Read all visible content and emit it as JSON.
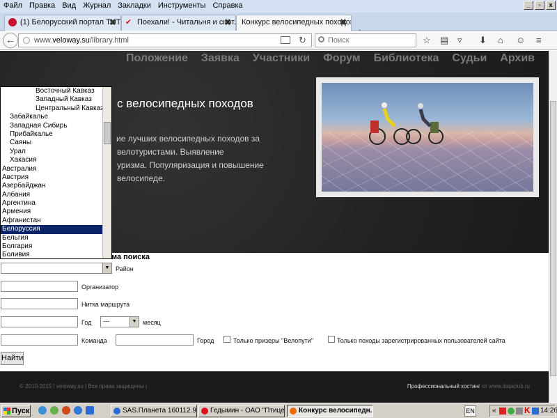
{
  "menu": {
    "items": [
      "Файл",
      "Правка",
      "Вид",
      "Журнал",
      "Закладки",
      "Инструменты",
      "Справка"
    ],
    "win_buttons": [
      "_",
      "▫",
      "x"
    ]
  },
  "tabs": [
    {
      "label": "(1) Белорусский портал TUT...",
      "icon_color": "#c8102e"
    },
    {
      "label": "Поехали! - Читальня и снот...",
      "icon_color": "#d11"
    },
    {
      "label": "Конкурс велосипедных походов ...",
      "icon_color": ""
    }
  ],
  "tab_close": "✖",
  "newtab": "+",
  "nav": {
    "back": "←",
    "url_prefix": "www.",
    "url_domain": "veloway.su",
    "url_path": "/library.html",
    "search_placeholder": "Поиск",
    "reload": "↻"
  },
  "page": {
    "topnav": [
      "Положение",
      "Заявка",
      "Участники",
      "Форум",
      "Библиотека",
      "Судьи",
      "Архив"
    ],
    "hero_title": "с велосипедных походов",
    "hero_desc_lines": [
      "ие лучших велосипедных походов за",
      "велотуристами. Выявление",
      "уризма. Популяризация и повышение",
      "велосипеде."
    ],
    "form_title": "ма поиска",
    "labels": {
      "region": "Район",
      "organizer": "Организатор",
      "route": "Нитка маршрута",
      "year": "Год",
      "month": "месяц",
      "team": "Команда",
      "city": "Город",
      "winners_only": "Только призеры \"Велопути\"",
      "registered_only": "Только походы зарегистрированных пользователей сайта"
    },
    "month_value": "---",
    "find_button": "Найти",
    "footer_left": "© 2010-2015 | veloway.su | Все права защищены |",
    "footer_right_text": "Профессиональный хостинг",
    "footer_right_from": "от",
    "footer_right_domain": "www.dataclub.ru"
  },
  "dropdown": {
    "items": [
      {
        "t": "Восточный Кавказ",
        "lvl": 2
      },
      {
        "t": "Западный Кавказ",
        "lvl": 2
      },
      {
        "t": "Центральный Кавказ",
        "lvl": 2
      },
      {
        "t": "Забайкалье",
        "lvl": 1
      },
      {
        "t": "Западная Сибирь",
        "lvl": 1
      },
      {
        "t": "Прибайкалье",
        "lvl": 1
      },
      {
        "t": "Саяны",
        "lvl": 1
      },
      {
        "t": "Урал",
        "lvl": 1
      },
      {
        "t": "Хакасия",
        "lvl": 1
      },
      {
        "t": "Австралия",
        "lvl": 0
      },
      {
        "t": "Австрия",
        "lvl": 0
      },
      {
        "t": "Азербайджан",
        "lvl": 0
      },
      {
        "t": "Албания",
        "lvl": 0
      },
      {
        "t": "Аргентина",
        "lvl": 0
      },
      {
        "t": "Армения",
        "lvl": 0
      },
      {
        "t": "Афганистан",
        "lvl": 0
      },
      {
        "t": "Белоруссия",
        "lvl": 0,
        "selected": true
      },
      {
        "t": "Бельгия",
        "lvl": 0
      },
      {
        "t": "Болгария",
        "lvl": 0
      },
      {
        "t": "Боливия",
        "lvl": 0
      }
    ]
  },
  "taskbar": {
    "start": "Пуск",
    "tasks": [
      {
        "label": "SAS.Планета 160112.9...",
        "icon_color": "#2a6bd6"
      },
      {
        "label": "Гедымин - ОАО \"Птице...",
        "icon_color": "#d12"
      },
      {
        "label": "Конкурс велосипедн...",
        "icon_color": "#e66b00",
        "active": true
      }
    ],
    "lang": "EN",
    "tray_arrows": "«",
    "clock": "14:26"
  },
  "colors": {
    "accent_selected": "#0a246a",
    "hero_bg": "#252525"
  }
}
